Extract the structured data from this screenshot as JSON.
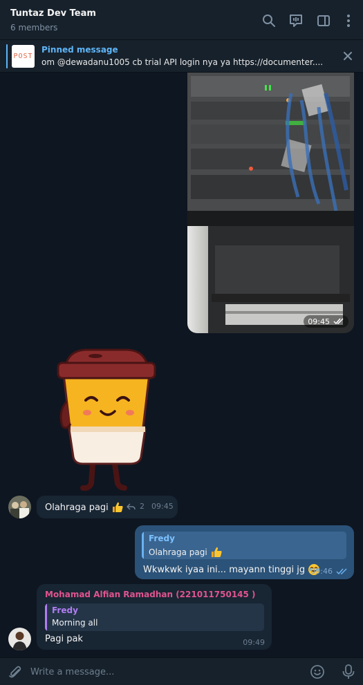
{
  "header": {
    "title": "Tuntaz Dev Team",
    "subtitle": "6 members",
    "icons": [
      "search-icon",
      "video-chat-icon",
      "sidebar-toggle-icon",
      "more-vertical-icon"
    ]
  },
  "pinned": {
    "title": "Pinned message",
    "text": "om @dewadanu1005 cb trial API login nya ya  https://documenter....",
    "thumb_text": "POST"
  },
  "messages": {
    "photo": {
      "time": "09:45",
      "status": "read"
    },
    "msg1": {
      "text": "Olahraga pagi",
      "emoji": "thumbs-up",
      "reply_count": "2",
      "time": "09:45"
    },
    "msg2": {
      "reply_name": "Fredy",
      "reply_text": "Olahraga pagi",
      "text": "Wkwkwk iyaa ini... mayann tinggi jg",
      "emoji": "laughing",
      "time": "09:46",
      "status": "read"
    },
    "msg3": {
      "sender": "Mohamad Alfian Ramadhan (221011750145 )",
      "reply_name": "Fredy",
      "reply_text": "Morning all",
      "text": "Pagi pak",
      "time": "09:49"
    }
  },
  "composer": {
    "placeholder": "Write a message..."
  },
  "colors": {
    "background": "#0e1621",
    "header": "#17212b",
    "incoming_bubble": "#182533",
    "outgoing_bubble": "#2b5278",
    "accent": "#5eb5f7",
    "sender_name": "#e0548f"
  }
}
